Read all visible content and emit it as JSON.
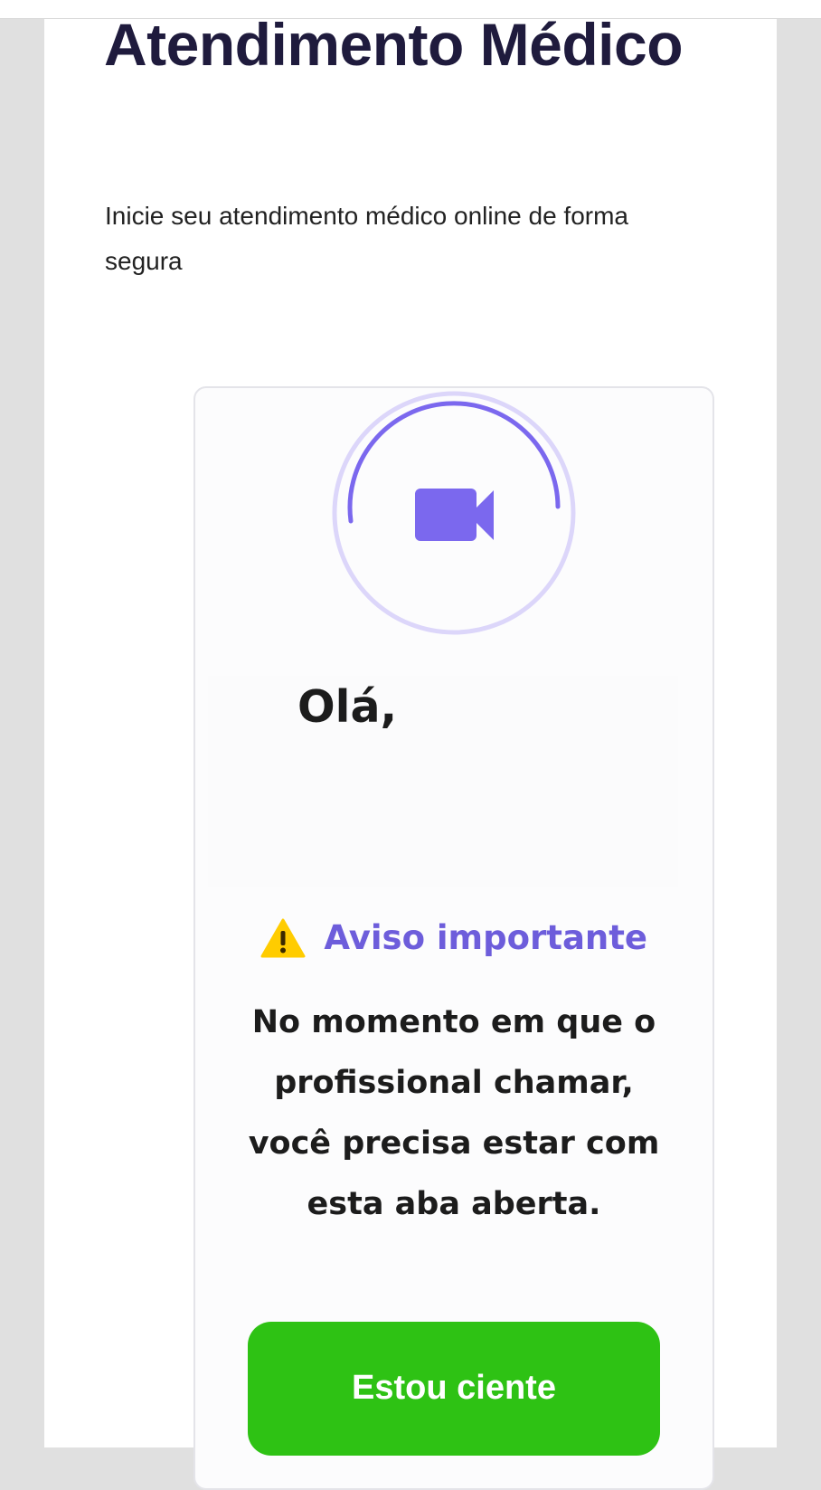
{
  "header": {
    "title": "Atendimento Médico",
    "subtitle": "Inicie seu atendimento médico online de forma segura"
  },
  "card": {
    "icon": "video-camera-icon",
    "greeting": "Olá,",
    "warning": {
      "icon": "warning-icon",
      "title": "Aviso importante",
      "text": "No momento em que o profissional chamar, você precisa estar com esta aba aberta."
    },
    "button_label": "Estou ciente"
  },
  "colors": {
    "accent": "#7b68ee",
    "ring": "#dcd6fa",
    "title": "#1f1b3d",
    "button": "#2ec214",
    "warning_icon": "#ffcc00"
  }
}
